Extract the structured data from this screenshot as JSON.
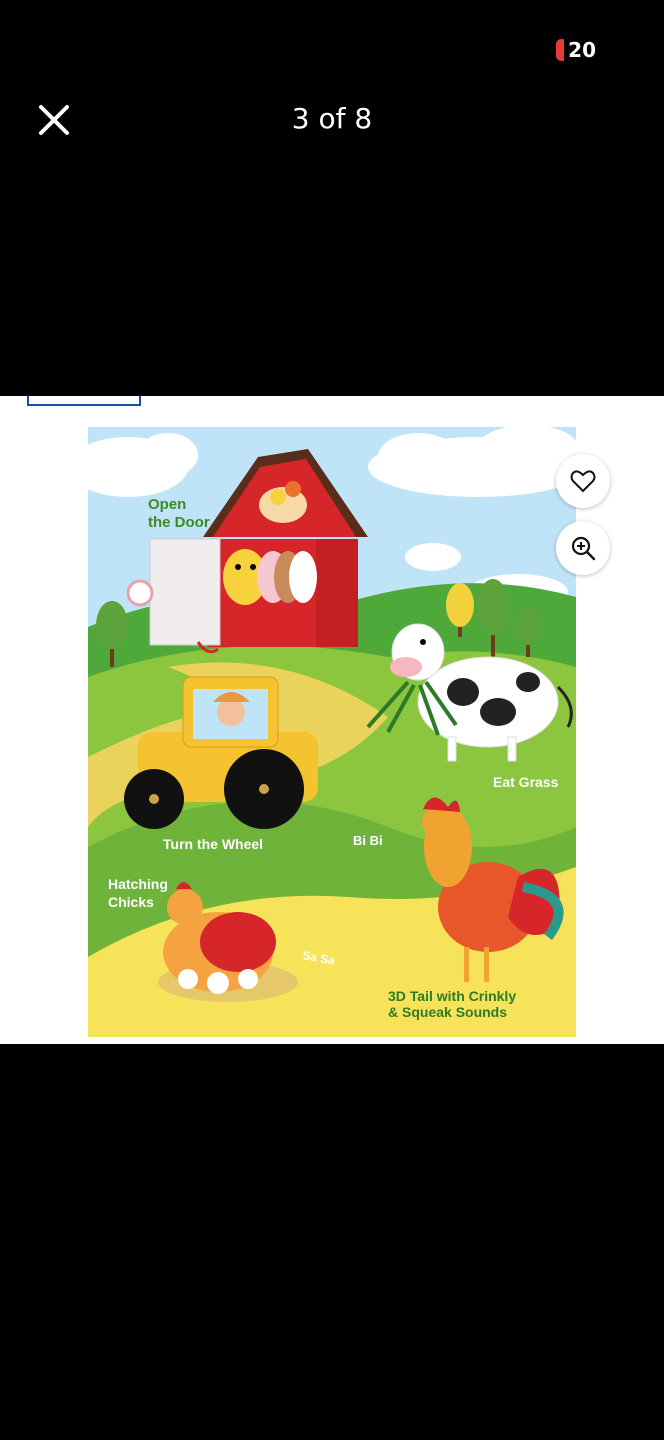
{
  "status": {
    "battery": "20"
  },
  "header": {
    "counter": "3 of 8"
  },
  "image": {
    "labels": {
      "open_door": [
        "Open",
        "the Door"
      ],
      "eat_grass": "Eat Grass",
      "turn_wheel": "Turn the Wheel",
      "hatching": [
        "Hatching",
        "Chicks"
      ],
      "bibi": "Bi Bi",
      "sasa": "Sa Sa",
      "tail": [
        "3D Tail with Crinkly",
        "& Squeak Sounds"
      ]
    }
  },
  "colors": {
    "background": "#000000",
    "accent": "#1a4fa8",
    "battery": "#e53935"
  }
}
